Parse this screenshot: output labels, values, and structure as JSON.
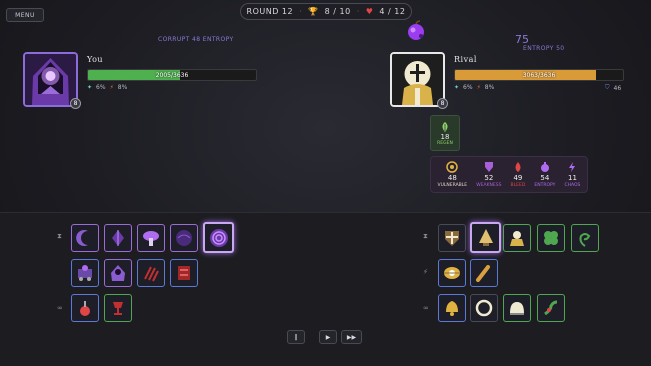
{
  "header": {
    "menu_label": "MENU",
    "round_label": "ROUND 12",
    "trophies": "8 / 10",
    "lives": "4 / 12"
  },
  "player": {
    "name": "You",
    "level": "8",
    "hp_text": "2005/3636",
    "hp_fraction": 0.55,
    "stat_a": "6%",
    "stat_b": "8%",
    "status": "CORRUPT  48 ENTROPY"
  },
  "rival": {
    "name": "Rival",
    "level": "8",
    "hp_text": "3063/3636",
    "hp_fraction": 0.84,
    "stat_a": "6%",
    "stat_b": "8%",
    "shield": "46",
    "entropy_number": "75",
    "entropy_label": "ENTROPY  50",
    "regen": {
      "value": "18",
      "label": "REGEN"
    },
    "effects": [
      {
        "value": "48",
        "label": "VULNERABLE",
        "color": "#e0b341",
        "icon": "target-icon"
      },
      {
        "value": "52",
        "label": "WEAKNESS",
        "color": "#a85fd8",
        "icon": "weakness-icon"
      },
      {
        "value": "49",
        "label": "BLEED",
        "color": "#e04646",
        "icon": "blood-drop-icon"
      },
      {
        "value": "54",
        "label": "ENTROPY",
        "color": "#b06cf0",
        "icon": "entropy-flask-icon"
      },
      {
        "value": "11",
        "label": "CHAOS",
        "color": "#b06cf0",
        "icon": "lightning-icon"
      }
    ]
  },
  "board": {
    "row_icons": [
      "⧗",
      "⚡",
      "∞"
    ],
    "player_rows": [
      [
        "crescent-moon-icon",
        "violet-shard-icon",
        "mushroom-icon",
        "void-orb-icon",
        "spiral-icon"
      ],
      [
        "potion-cart-icon",
        "hooded-figure-icon",
        "claw-marks-icon",
        "blood-tome-icon"
      ],
      [
        "red-potion-icon",
        "chalice-icon"
      ]
    ],
    "rival_rows": [
      [
        "shield-crest-icon",
        "lantern-icon",
        "sage-icon",
        "clover-icon",
        "fern-icon"
      ],
      [
        "golden-eye-icon",
        "club-icon"
      ],
      [
        "bell-icon",
        "laurel-icon",
        "dome-icon",
        "gecko-icon"
      ]
    ]
  },
  "controls": {
    "pause": "‖",
    "play": "▶",
    "fast": "▶▶"
  },
  "colors": {
    "player_hp": "#4fb04f",
    "rival_hp": "#d99a38",
    "accent": "#8a7ad6"
  }
}
